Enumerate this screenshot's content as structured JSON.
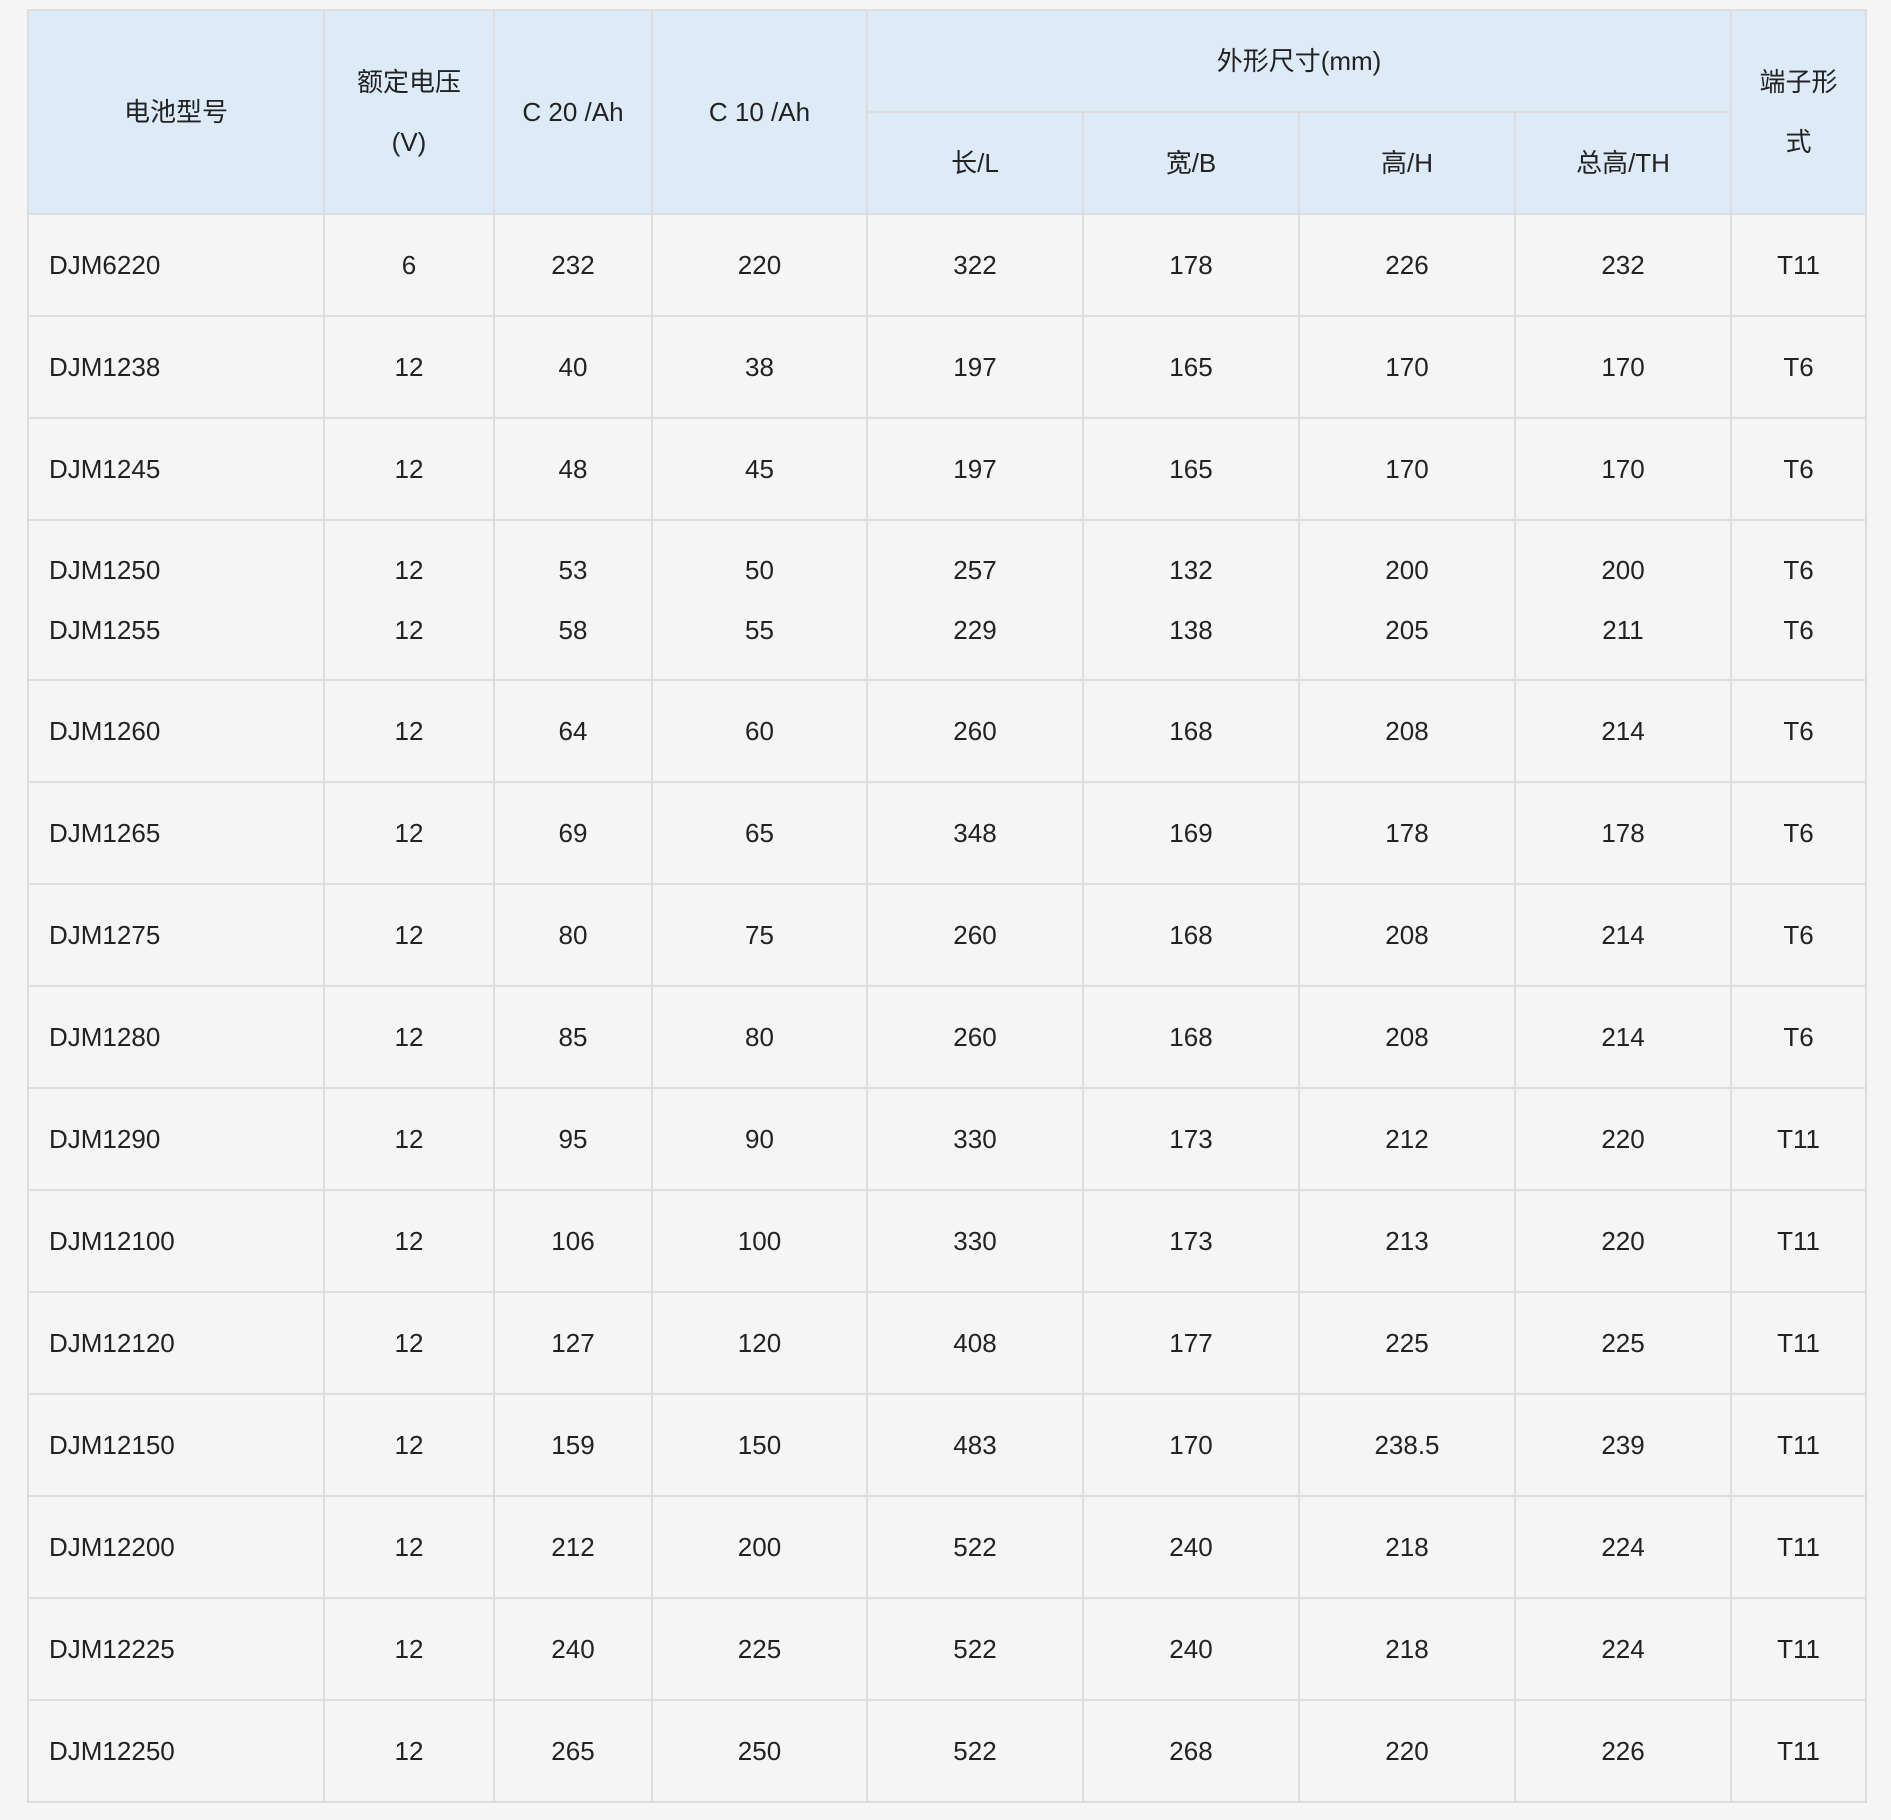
{
  "table": {
    "headers": {
      "model": "电池型号",
      "voltage_line1": "额定电压",
      "voltage_line2": "(V)",
      "c20": "C 20 /Ah",
      "c10": "C 10 /Ah",
      "dimensions": "外形尺寸(mm)",
      "length": "长/L",
      "width": "宽/B",
      "height": "高/H",
      "total_height": "总高/TH",
      "terminal_line1": "端子形",
      "terminal_line2": "式"
    },
    "rows": [
      {
        "model": "DJM6220",
        "voltage": "6",
        "c20": "232",
        "c10": "220",
        "length": "322",
        "width": "178",
        "height": "226",
        "total_height": "232",
        "terminal": "T11"
      },
      {
        "model": "DJM1238",
        "voltage": "12",
        "c20": "40",
        "c10": "38",
        "length": "197",
        "width": "165",
        "height": "170",
        "total_height": "170",
        "terminal": "T6"
      },
      {
        "model": "DJM1245",
        "voltage": "12",
        "c20": "48",
        "c10": "45",
        "length": "197",
        "width": "165",
        "height": "170",
        "total_height": "170",
        "terminal": "T6"
      },
      {
        "model": "DJM1250",
        "voltage": "12",
        "c20": "53",
        "c10": "50",
        "length": "257",
        "width": "132",
        "height": "200",
        "total_height": "200",
        "terminal": "T6"
      },
      {
        "model": "DJM1255",
        "voltage": "12",
        "c20": "58",
        "c10": "55",
        "length": "229",
        "width": "138",
        "height": "205",
        "total_height": "211",
        "terminal": "T6"
      },
      {
        "model": "DJM1260",
        "voltage": "12",
        "c20": "64",
        "c10": "60",
        "length": "260",
        "width": "168",
        "height": "208",
        "total_height": "214",
        "terminal": "T6"
      },
      {
        "model": "DJM1265",
        "voltage": "12",
        "c20": "69",
        "c10": "65",
        "length": "348",
        "width": "169",
        "height": "178",
        "total_height": "178",
        "terminal": "T6"
      },
      {
        "model": "DJM1275",
        "voltage": "12",
        "c20": "80",
        "c10": "75",
        "length": "260",
        "width": "168",
        "height": "208",
        "total_height": "214",
        "terminal": "T6"
      },
      {
        "model": "DJM1280",
        "voltage": "12",
        "c20": "85",
        "c10": "80",
        "length": "260",
        "width": "168",
        "height": "208",
        "total_height": "214",
        "terminal": "T6"
      },
      {
        "model": "DJM1290",
        "voltage": "12",
        "c20": "95",
        "c10": "90",
        "length": "330",
        "width": "173",
        "height": "212",
        "total_height": "220",
        "terminal": "T11"
      },
      {
        "model": "DJM12100",
        "voltage": "12",
        "c20": "106",
        "c10": "100",
        "length": "330",
        "width": "173",
        "height": "213",
        "total_height": "220",
        "terminal": "T11"
      },
      {
        "model": "DJM12120",
        "voltage": "12",
        "c20": "127",
        "c10": "120",
        "length": "408",
        "width": "177",
        "height": "225",
        "total_height": "225",
        "terminal": "T11"
      },
      {
        "model": "DJM12150",
        "voltage": "12",
        "c20": "159",
        "c10": "150",
        "length": "483",
        "width": "170",
        "height": "238.5",
        "total_height": "239",
        "terminal": "T11"
      },
      {
        "model": "DJM12200",
        "voltage": "12",
        "c20": "212",
        "c10": "200",
        "length": "522",
        "width": "240",
        "height": "218",
        "total_height": "224",
        "terminal": "T11"
      },
      {
        "model": "DJM12225",
        "voltage": "12",
        "c20": "240",
        "c10": "225",
        "length": "522",
        "width": "240",
        "height": "218",
        "total_height": "224",
        "terminal": "T11"
      },
      {
        "model": "DJM12250",
        "voltage": "12",
        "c20": "265",
        "c10": "250",
        "length": "522",
        "width": "268",
        "height": "220",
        "total_height": "226",
        "terminal": "T11"
      }
    ]
  },
  "colors": {
    "header_bg": "#dcebf7",
    "body_bg": "#f5f5f5",
    "border": "#dddddd"
  }
}
